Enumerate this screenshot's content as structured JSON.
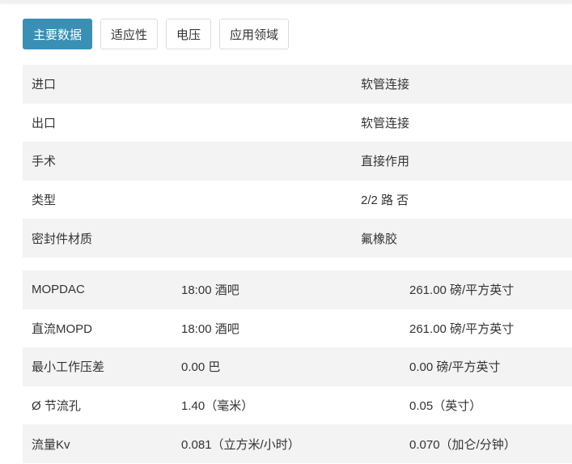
{
  "tabs": [
    {
      "label": "主要数据",
      "active": true
    },
    {
      "label": "适应性",
      "active": false
    },
    {
      "label": "电压",
      "active": false
    },
    {
      "label": "应用领域",
      "active": false
    }
  ],
  "main_table": [
    {
      "name": "进口",
      "value": "软管连接"
    },
    {
      "name": "出口",
      "value": "软管连接"
    },
    {
      "name": "手术",
      "value": "直接作用"
    },
    {
      "name": "类型",
      "value": "2/2 路 否"
    },
    {
      "name": "密封件材质",
      "value": "氟橡胶"
    }
  ],
  "spec_table": [
    {
      "name": "MOPDAC",
      "metric": "18:00 酒吧",
      "imperial": "261.00 磅/平方英寸"
    },
    {
      "name": "直流MOPD",
      "metric": "18:00 酒吧",
      "imperial": "261.00 磅/平方英寸"
    },
    {
      "name": "最小工作压差",
      "metric": "0.00 巴",
      "imperial": "0.00 磅/平方英寸"
    },
    {
      "name": "Ø 节流孔",
      "metric": "1.40（毫米）",
      "imperial": "0.05（英寸）"
    },
    {
      "name": "流量Kv",
      "metric": "0.081（立方米/小时）",
      "imperial": "0.070（加仑/分钟）"
    }
  ],
  "colors": {
    "accent": "#3a8fb5",
    "row_alt": "#f3f3f3"
  }
}
